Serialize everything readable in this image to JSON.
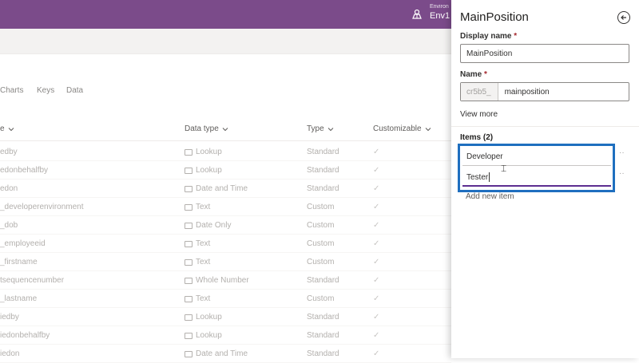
{
  "topbar": {
    "env_label": "Environ",
    "env_name": "Env1",
    "env_icon": "environment-icon",
    "color": "#7b4b8a"
  },
  "tabs": [
    "Charts",
    "Keys",
    "Data"
  ],
  "table": {
    "headers": {
      "name": "e",
      "data_type": "Data type",
      "type": "Type",
      "customizable": "Customizable"
    },
    "rows": [
      {
        "name": "edby",
        "data_type": "Lookup",
        "type": "Standard"
      },
      {
        "name": "edonbehalfby",
        "data_type": "Lookup",
        "type": "Standard"
      },
      {
        "name": "edon",
        "data_type": "Date and Time",
        "type": "Standard"
      },
      {
        "name": "_developerenvironment",
        "data_type": "Text",
        "type": "Custom"
      },
      {
        "name": "_dob",
        "data_type": "Date Only",
        "type": "Custom"
      },
      {
        "name": "_employeeid",
        "data_type": "Text",
        "type": "Custom"
      },
      {
        "name": "_firstname",
        "data_type": "Text",
        "type": "Custom"
      },
      {
        "name": "tsequencenumber",
        "data_type": "Whole Number",
        "type": "Standard"
      },
      {
        "name": "_lastname",
        "data_type": "Text",
        "type": "Custom"
      },
      {
        "name": "iedby",
        "data_type": "Lookup",
        "type": "Standard"
      },
      {
        "name": "iedonbehalfby",
        "data_type": "Lookup",
        "type": "Standard"
      },
      {
        "name": "iedon",
        "data_type": "Date and Time",
        "type": "Standard"
      }
    ],
    "check_glyph": "✓"
  },
  "panel": {
    "title": "MainPosition",
    "back_icon": "arrow-left-circle-icon",
    "display_name_label": "Display name",
    "display_name_value": "MainPosition",
    "name_label": "Name",
    "required_marker": "*",
    "name_prefix": "cr5b5_",
    "name_value": "mainposition",
    "view_more": "View more",
    "items_label": "Items (2)",
    "items": [
      "Developer",
      "Tester"
    ],
    "add_new_item": "Add new item",
    "accent": "#1f6fbf"
  }
}
